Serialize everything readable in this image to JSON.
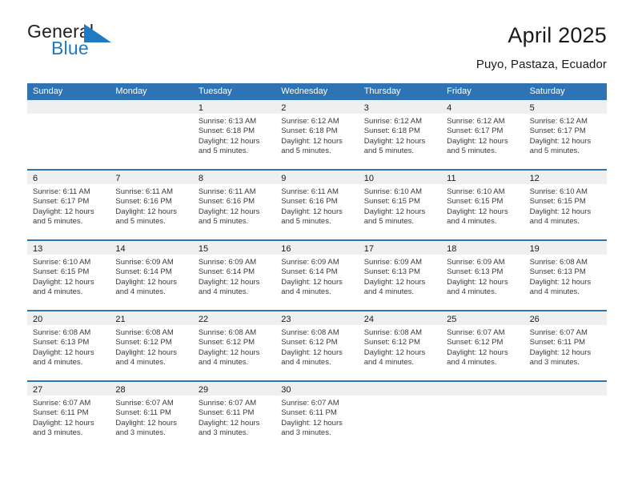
{
  "brand": {
    "name_part1": "General",
    "name_part2": "Blue",
    "flag_color": "#1f7ac4"
  },
  "header": {
    "title": "April 2025",
    "subtitle": "Puyo, Pastaza, Ecuador"
  },
  "theme": {
    "header_blue": "#2e74b5",
    "band_gray": "#efefef",
    "text_dark": "#1a1a1a",
    "text_body": "#3a3a3a"
  },
  "weekday_headers": [
    "Sunday",
    "Monday",
    "Tuesday",
    "Wednesday",
    "Thursday",
    "Friday",
    "Saturday"
  ],
  "weeks": [
    [
      {
        "day": "",
        "lines": []
      },
      {
        "day": "",
        "lines": []
      },
      {
        "day": "1",
        "lines": [
          "Sunrise: 6:13 AM",
          "Sunset: 6:18 PM",
          "Daylight: 12 hours",
          "and 5 minutes."
        ]
      },
      {
        "day": "2",
        "lines": [
          "Sunrise: 6:12 AM",
          "Sunset: 6:18 PM",
          "Daylight: 12 hours",
          "and 5 minutes."
        ]
      },
      {
        "day": "3",
        "lines": [
          "Sunrise: 6:12 AM",
          "Sunset: 6:18 PM",
          "Daylight: 12 hours",
          "and 5 minutes."
        ]
      },
      {
        "day": "4",
        "lines": [
          "Sunrise: 6:12 AM",
          "Sunset: 6:17 PM",
          "Daylight: 12 hours",
          "and 5 minutes."
        ]
      },
      {
        "day": "5",
        "lines": [
          "Sunrise: 6:12 AM",
          "Sunset: 6:17 PM",
          "Daylight: 12 hours",
          "and 5 minutes."
        ]
      }
    ],
    [
      {
        "day": "6",
        "lines": [
          "Sunrise: 6:11 AM",
          "Sunset: 6:17 PM",
          "Daylight: 12 hours",
          "and 5 minutes."
        ]
      },
      {
        "day": "7",
        "lines": [
          "Sunrise: 6:11 AM",
          "Sunset: 6:16 PM",
          "Daylight: 12 hours",
          "and 5 minutes."
        ]
      },
      {
        "day": "8",
        "lines": [
          "Sunrise: 6:11 AM",
          "Sunset: 6:16 PM",
          "Daylight: 12 hours",
          "and 5 minutes."
        ]
      },
      {
        "day": "9",
        "lines": [
          "Sunrise: 6:11 AM",
          "Sunset: 6:16 PM",
          "Daylight: 12 hours",
          "and 5 minutes."
        ]
      },
      {
        "day": "10",
        "lines": [
          "Sunrise: 6:10 AM",
          "Sunset: 6:15 PM",
          "Daylight: 12 hours",
          "and 5 minutes."
        ]
      },
      {
        "day": "11",
        "lines": [
          "Sunrise: 6:10 AM",
          "Sunset: 6:15 PM",
          "Daylight: 12 hours",
          "and 4 minutes."
        ]
      },
      {
        "day": "12",
        "lines": [
          "Sunrise: 6:10 AM",
          "Sunset: 6:15 PM",
          "Daylight: 12 hours",
          "and 4 minutes."
        ]
      }
    ],
    [
      {
        "day": "13",
        "lines": [
          "Sunrise: 6:10 AM",
          "Sunset: 6:15 PM",
          "Daylight: 12 hours",
          "and 4 minutes."
        ]
      },
      {
        "day": "14",
        "lines": [
          "Sunrise: 6:09 AM",
          "Sunset: 6:14 PM",
          "Daylight: 12 hours",
          "and 4 minutes."
        ]
      },
      {
        "day": "15",
        "lines": [
          "Sunrise: 6:09 AM",
          "Sunset: 6:14 PM",
          "Daylight: 12 hours",
          "and 4 minutes."
        ]
      },
      {
        "day": "16",
        "lines": [
          "Sunrise: 6:09 AM",
          "Sunset: 6:14 PM",
          "Daylight: 12 hours",
          "and 4 minutes."
        ]
      },
      {
        "day": "17",
        "lines": [
          "Sunrise: 6:09 AM",
          "Sunset: 6:13 PM",
          "Daylight: 12 hours",
          "and 4 minutes."
        ]
      },
      {
        "day": "18",
        "lines": [
          "Sunrise: 6:09 AM",
          "Sunset: 6:13 PM",
          "Daylight: 12 hours",
          "and 4 minutes."
        ]
      },
      {
        "day": "19",
        "lines": [
          "Sunrise: 6:08 AM",
          "Sunset: 6:13 PM",
          "Daylight: 12 hours",
          "and 4 minutes."
        ]
      }
    ],
    [
      {
        "day": "20",
        "lines": [
          "Sunrise: 6:08 AM",
          "Sunset: 6:13 PM",
          "Daylight: 12 hours",
          "and 4 minutes."
        ]
      },
      {
        "day": "21",
        "lines": [
          "Sunrise: 6:08 AM",
          "Sunset: 6:12 PM",
          "Daylight: 12 hours",
          "and 4 minutes."
        ]
      },
      {
        "day": "22",
        "lines": [
          "Sunrise: 6:08 AM",
          "Sunset: 6:12 PM",
          "Daylight: 12 hours",
          "and 4 minutes."
        ]
      },
      {
        "day": "23",
        "lines": [
          "Sunrise: 6:08 AM",
          "Sunset: 6:12 PM",
          "Daylight: 12 hours",
          "and 4 minutes."
        ]
      },
      {
        "day": "24",
        "lines": [
          "Sunrise: 6:08 AM",
          "Sunset: 6:12 PM",
          "Daylight: 12 hours",
          "and 4 minutes."
        ]
      },
      {
        "day": "25",
        "lines": [
          "Sunrise: 6:07 AM",
          "Sunset: 6:12 PM",
          "Daylight: 12 hours",
          "and 4 minutes."
        ]
      },
      {
        "day": "26",
        "lines": [
          "Sunrise: 6:07 AM",
          "Sunset: 6:11 PM",
          "Daylight: 12 hours",
          "and 3 minutes."
        ]
      }
    ],
    [
      {
        "day": "27",
        "lines": [
          "Sunrise: 6:07 AM",
          "Sunset: 6:11 PM",
          "Daylight: 12 hours",
          "and 3 minutes."
        ]
      },
      {
        "day": "28",
        "lines": [
          "Sunrise: 6:07 AM",
          "Sunset: 6:11 PM",
          "Daylight: 12 hours",
          "and 3 minutes."
        ]
      },
      {
        "day": "29",
        "lines": [
          "Sunrise: 6:07 AM",
          "Sunset: 6:11 PM",
          "Daylight: 12 hours",
          "and 3 minutes."
        ]
      },
      {
        "day": "30",
        "lines": [
          "Sunrise: 6:07 AM",
          "Sunset: 6:11 PM",
          "Daylight: 12 hours",
          "and 3 minutes."
        ]
      },
      {
        "day": "",
        "lines": []
      },
      {
        "day": "",
        "lines": []
      },
      {
        "day": "",
        "lines": []
      }
    ]
  ]
}
